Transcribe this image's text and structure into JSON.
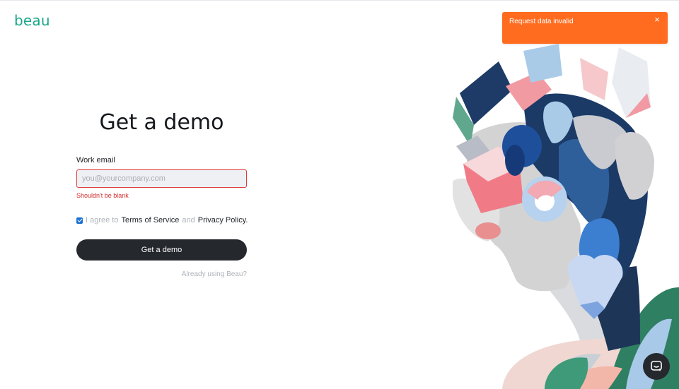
{
  "brand": {
    "logo_text": "beau"
  },
  "toast": {
    "message": "Request data invalid",
    "close_glyph": "×",
    "color": "#ff6c1f"
  },
  "form": {
    "title": "Get a demo",
    "email_label": "Work email",
    "email_placeholder": "you@yourcompany.com",
    "email_value": "",
    "error_text": "Shouldn't be blank",
    "agree": {
      "checked": true,
      "prefix": "I agree to",
      "terms_link": "Terms of Service",
      "conjunction": "and",
      "privacy_link": "Privacy Policy."
    },
    "submit_label": "Get a demo",
    "already_link": "Already using Beau?"
  },
  "chat": {
    "icon": "chat-bubble-icon"
  },
  "colors": {
    "brand": "#1aa68b",
    "button": "#25282d",
    "error": "#d42c2c",
    "checkbox": "#1a6fd4"
  }
}
